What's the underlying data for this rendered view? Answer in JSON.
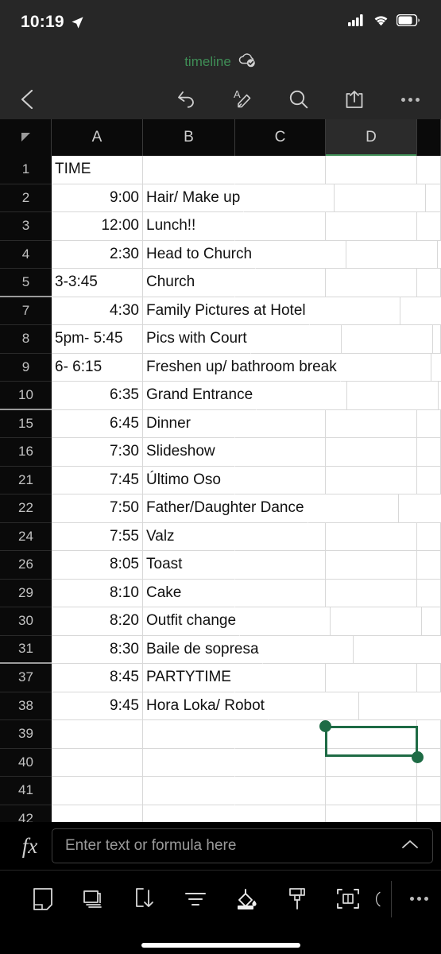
{
  "status_bar": {
    "time": "10:19",
    "location_icon": "location-arrow-icon",
    "signal_icon": "cellular-signal-icon",
    "wifi_icon": "wifi-icon",
    "battery_icon": "battery-icon"
  },
  "title_bar": {
    "document_name": "timeline",
    "sync_icon": "cloud-saved-check-icon",
    "title_color": "#3f8d56"
  },
  "toolbar": {
    "back_icon": "chevron-left-icon",
    "undo_icon": "undo-icon",
    "edit_icon": "edit-text-pen-icon",
    "search_icon": "search-icon",
    "share_icon": "share-icon",
    "more_icon": "more-horizontal-icon"
  },
  "spreadsheet": {
    "select_all_icon": "select-all-triangle-icon",
    "columns": [
      "A",
      "B",
      "C",
      "D"
    ],
    "selected_column": "D",
    "selection": {
      "range": "D30",
      "color": "#1e6b45"
    },
    "rows": [
      {
        "num": "1",
        "a": "TIME",
        "a_align": "txt",
        "b": "",
        "gap_after": false
      },
      {
        "num": "2",
        "a": "9:00",
        "a_align": "num",
        "b": "Hair/ Make up",
        "gap_after": false
      },
      {
        "num": "3",
        "a": "12:00",
        "a_align": "num",
        "b": "Lunch!!",
        "gap_after": false
      },
      {
        "num": "4",
        "a": "2:30",
        "a_align": "num",
        "b": "Head to Church",
        "gap_after": false
      },
      {
        "num": "5",
        "a": "3-3:45",
        "a_align": "txt",
        "b": "Church",
        "gap_after": true
      },
      {
        "num": "7",
        "a": "4:30",
        "a_align": "num",
        "b": "Family Pictures at Hotel",
        "gap_after": false
      },
      {
        "num": "8",
        "a": "5pm- 5:45",
        "a_align": "txt",
        "b": "Pics with Court",
        "gap_after": false
      },
      {
        "num": "9",
        "a": "6- 6:15",
        "a_align": "txt",
        "b": "Freshen up/ bathroom break",
        "gap_after": false
      },
      {
        "num": "10",
        "a": "6:35",
        "a_align": "num",
        "b": "Grand Entrance",
        "gap_after": true
      },
      {
        "num": "15",
        "a": "6:45",
        "a_align": "num",
        "b": "Dinner",
        "gap_after": false
      },
      {
        "num": "16",
        "a": "7:30",
        "a_align": "num",
        "b": "Slideshow",
        "gap_after": false
      },
      {
        "num": "21",
        "a": "7:45",
        "a_align": "num",
        "b": "Último Oso",
        "gap_after": false
      },
      {
        "num": "22",
        "a": "7:50",
        "a_align": "num",
        "b": "Father/Daughter Dance",
        "gap_after": false
      },
      {
        "num": "24",
        "a": "7:55",
        "a_align": "num",
        "b": "Valz",
        "gap_after": false
      },
      {
        "num": "26",
        "a": "8:05",
        "a_align": "num",
        "b": "Toast",
        "gap_after": false
      },
      {
        "num": "29",
        "a": "8:10",
        "a_align": "num",
        "b": "Cake",
        "gap_after": false
      },
      {
        "num": "30",
        "a": "8:20",
        "a_align": "num",
        "b": "Outfit change",
        "gap_after": false
      },
      {
        "num": "31",
        "a": "8:30",
        "a_align": "num",
        "b": "Baile de sopresa",
        "gap_after": true
      },
      {
        "num": "37",
        "a": "8:45",
        "a_align": "num",
        "b": "PARTYTIME",
        "gap_after": false
      },
      {
        "num": "38",
        "a": "9:45",
        "a_align": "num",
        "b": "Hora Loka/ Robot",
        "gap_after": false
      },
      {
        "num": "39",
        "a": "",
        "a_align": "num",
        "b": "",
        "gap_after": false
      },
      {
        "num": "40",
        "a": "",
        "a_align": "num",
        "b": "",
        "gap_after": false
      },
      {
        "num": "41",
        "a": "",
        "a_align": "num",
        "b": "",
        "gap_after": false
      },
      {
        "num": "42",
        "a": "",
        "a_align": "num",
        "b": "",
        "gap_after": false
      }
    ]
  },
  "formula_bar": {
    "fx_label": "fx",
    "placeholder": "Enter text or formula here",
    "value": "",
    "expand_icon": "chevron-up-icon"
  },
  "bottom_toolbar": {
    "items": [
      {
        "icon": "sheet-page-icon"
      },
      {
        "icon": "duplicate-cards-icon"
      },
      {
        "icon": "insert-cells-down-icon"
      },
      {
        "icon": "filter-icon"
      },
      {
        "icon": "fill-color-icon"
      },
      {
        "icon": "format-painter-brush-icon"
      },
      {
        "icon": "merge-cells-icon"
      },
      {
        "icon": "partial-cut-icon"
      }
    ],
    "more_icon": "more-horizontal-icon"
  }
}
